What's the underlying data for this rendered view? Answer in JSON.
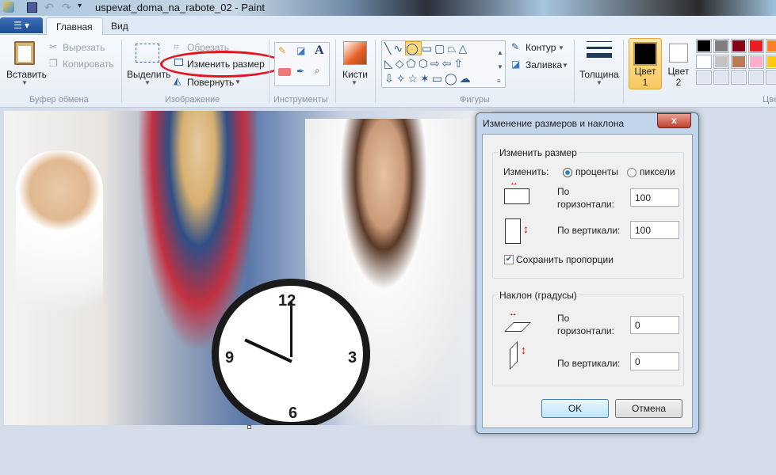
{
  "window": {
    "title": "uspevat_doma_na_rabote_02 - Paint"
  },
  "tabs": [
    {
      "label": "Главная"
    },
    {
      "label": "Вид"
    }
  ],
  "clipboard": {
    "paste": "Вставить",
    "cut": "Вырезать",
    "copy": "Копировать",
    "group": "Буфер обмена"
  },
  "image": {
    "select": "Выделить",
    "crop": "Обрезать",
    "resize": "Изменить размер",
    "rotate": "Повернуть",
    "group": "Изображение"
  },
  "tools": {
    "group": "Инструменты",
    "brushes": "Кисти"
  },
  "shapes": {
    "group": "Фигуры",
    "outline": "Контур",
    "fill": "Заливка"
  },
  "size": {
    "label": "Толщина"
  },
  "colors": {
    "color1": "Цвет",
    "color1_num": "1",
    "color2": "Цвет",
    "color2_num": "2",
    "group": "Цве",
    "palette": [
      "#000000",
      "#7f7f7f",
      "#880015",
      "#ed1c24",
      "#ff7f27",
      "#ffffff",
      "#c3c3c3",
      "#b97a57",
      "#ffaec9",
      "#ffc90e"
    ]
  },
  "dialog": {
    "title": "Изменение размеров и наклона",
    "close": "x",
    "resize": {
      "legend": "Изменить размер",
      "by": "Изменить:",
      "percent": "проценты",
      "pixels": "пиксели",
      "horizontal": "По горизонтали:",
      "vertical": "По вертикали:",
      "h_value": "100",
      "v_value": "100",
      "keep": "Сохранить пропорции",
      "keep_checked": true
    },
    "skew": {
      "legend": "Наклон (градусы)",
      "horizontal": "По горизонтали:",
      "vertical": "По вертикали:",
      "h_value": "0",
      "v_value": "0"
    },
    "ok": "OK",
    "cancel": "Отмена"
  },
  "accent": {
    "highlight": "#e3141c"
  }
}
